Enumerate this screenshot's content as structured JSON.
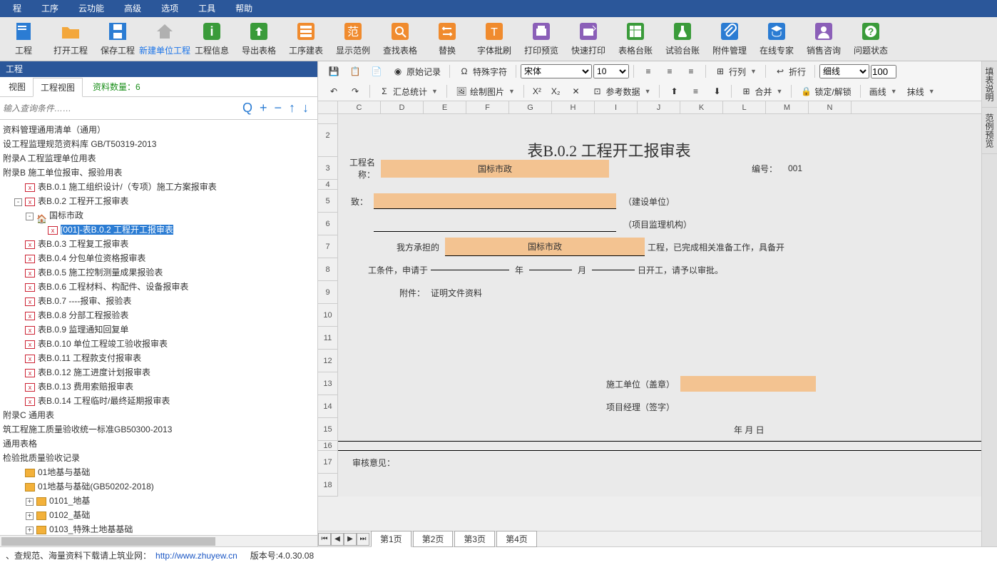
{
  "menu": [
    "程",
    "工序",
    "云功能",
    "高级",
    "选项",
    "工具",
    "帮助"
  ],
  "toolbar": [
    {
      "icon": "file-blue",
      "label": "工程"
    },
    {
      "icon": "folder-open",
      "label": "打开工程"
    },
    {
      "icon": "save",
      "label": "保存工程"
    },
    {
      "icon": "home-grey",
      "label": "新建单位工程",
      "accent": true
    },
    {
      "icon": "info",
      "label": "工程信息"
    },
    {
      "icon": "export",
      "label": "导出表格"
    },
    {
      "icon": "build",
      "label": "工序建表"
    },
    {
      "icon": "template",
      "label": "显示范例"
    },
    {
      "icon": "search",
      "label": "查找表格"
    },
    {
      "icon": "replace",
      "label": "替换"
    },
    {
      "icon": "font",
      "label": "字体批刷"
    },
    {
      "icon": "print",
      "label": "打印预览"
    },
    {
      "icon": "quick-print",
      "label": "快速打印"
    },
    {
      "icon": "ledger",
      "label": "表格台账"
    },
    {
      "icon": "test",
      "label": "试验台账"
    },
    {
      "icon": "attach",
      "label": "附件管理"
    },
    {
      "icon": "expert",
      "label": "在线专家"
    },
    {
      "icon": "sales",
      "label": "销售咨询"
    },
    {
      "icon": "status",
      "label": "问题状态"
    }
  ],
  "left": {
    "title": "工程",
    "tabs": [
      "视图",
      "工程视图"
    ],
    "info": "资料数量：6",
    "search_placeholder": "输入查询条件……",
    "tree": [
      {
        "lvl": 1,
        "t": "资料管理通用清单（通用）"
      },
      {
        "lvl": 1,
        "t": "设工程监理规范资料库  GB/T50319-2013"
      },
      {
        "lvl": 1,
        "t": "附录A 工程监理单位用表"
      },
      {
        "lvl": 1,
        "t": "附录B 施工单位报审、报验用表"
      },
      {
        "lvl": 2,
        "ico": "doc",
        "t": "表B.0.1 施工组织设计/（专项）施工方案报审表"
      },
      {
        "lvl": 2,
        "ico": "doc",
        "t": "表B.0.2 工程开工报审表",
        "exp": "-"
      },
      {
        "lvl": 3,
        "ico": "home",
        "t": "国标市政",
        "exp": "-"
      },
      {
        "lvl": 4,
        "ico": "doc",
        "t": "[001]-表B.0.2 工程开工报审表",
        "sel": true
      },
      {
        "lvl": 2,
        "ico": "doc",
        "t": "表B.0.3 工程复工报审表"
      },
      {
        "lvl": 2,
        "ico": "doc",
        "t": "表B.0.4 分包单位资格报审表"
      },
      {
        "lvl": 2,
        "ico": "doc",
        "t": "表B.0.5 施工控制测量成果报验表"
      },
      {
        "lvl": 2,
        "ico": "doc",
        "t": "表B.0.6 工程材料、构配件、设备报审表"
      },
      {
        "lvl": 2,
        "ico": "doc",
        "t": "表B.0.7 ----报审、报验表"
      },
      {
        "lvl": 2,
        "ico": "doc",
        "t": "表B.0.8 分部工程报验表"
      },
      {
        "lvl": 2,
        "ico": "doc",
        "t": "表B.0.9 监理通知回复单"
      },
      {
        "lvl": 2,
        "ico": "doc",
        "t": "表B.0.10 单位工程竣工验收报审表"
      },
      {
        "lvl": 2,
        "ico": "doc",
        "t": "表B.0.11 工程款支付报审表"
      },
      {
        "lvl": 2,
        "ico": "doc",
        "t": "表B.0.12 施工进度计划报审表"
      },
      {
        "lvl": 2,
        "ico": "doc",
        "t": "表B.0.13 费用索赔报审表"
      },
      {
        "lvl": 2,
        "ico": "doc",
        "t": "表B.0.14 工程临时/最终延期报审表"
      },
      {
        "lvl": 1,
        "t": "附录C 通用表"
      },
      {
        "lvl": 1,
        "t": "筑工程施工质量验收统一标准GB50300-2013"
      },
      {
        "lvl": 1,
        "t": "通用表格"
      },
      {
        "lvl": 1,
        "t": "检验批质量验收记录"
      },
      {
        "lvl": 2,
        "ico": "fld",
        "t": "01地基与基础"
      },
      {
        "lvl": 2,
        "ico": "fld",
        "t": "01地基与基础(GB50202-2018)"
      },
      {
        "lvl": 3,
        "ico": "fld",
        "exp": "+",
        "t": "0101_地基"
      },
      {
        "lvl": 3,
        "ico": "fld",
        "exp": "+",
        "t": "0102_基础"
      },
      {
        "lvl": 3,
        "ico": "fld",
        "exp": "+",
        "t": "0103_特殊土地基基础"
      }
    ]
  },
  "rtool": {
    "row1": [
      {
        "ico": "disk",
        "t": ""
      },
      {
        "ico": "copy",
        "t": ""
      },
      {
        "ico": "paste",
        "t": ""
      },
      {
        "ico": "orig",
        "t": "原始记录"
      },
      {
        "sep": true
      },
      {
        "ico": "omega",
        "t": "特殊字符"
      },
      {
        "sep": true
      },
      {
        "font_sel": "宋体"
      },
      {
        "size_sel": "10"
      },
      {
        "sep": true
      },
      {
        "ico": "al",
        "t": ""
      },
      {
        "ico": "ac",
        "t": ""
      },
      {
        "ico": "ar",
        "t": ""
      },
      {
        "sep": true
      },
      {
        "ico": "row",
        "t": "行列",
        "drop": true
      },
      {
        "sep": true
      },
      {
        "ico": "wrap",
        "t": "折行"
      },
      {
        "sep": true
      },
      {
        "sel": "细线"
      },
      {
        "num": "100"
      }
    ],
    "row2": [
      {
        "ico": "undo",
        "t": ""
      },
      {
        "ico": "redo",
        "t": ""
      },
      {
        "sep": true
      },
      {
        "ico": "sum",
        "t": "汇总统计",
        "drop": true
      },
      {
        "sep": true
      },
      {
        "ico": "img",
        "t": "绘制图片",
        "drop": true
      },
      {
        "sep": true
      },
      {
        "t": "X²"
      },
      {
        "t": "X₂"
      },
      {
        "ico": "del",
        "t": ""
      },
      {
        "ico": "ref",
        "t": "参考数据",
        "drop": true
      },
      {
        "sep": true
      },
      {
        "ico": "vt",
        "t": ""
      },
      {
        "ico": "vm",
        "t": ""
      },
      {
        "ico": "vb",
        "t": ""
      },
      {
        "sep": true
      },
      {
        "ico": "merge",
        "t": "合并",
        "drop": true
      },
      {
        "sep": true
      },
      {
        "ico": "lock",
        "t": "锁定/解锁"
      },
      {
        "sep": true
      },
      {
        "t": "画线",
        "drop": true
      },
      {
        "t": "抹线",
        "drop": true
      }
    ]
  },
  "sheet": {
    "cols": [
      "",
      "C",
      "D",
      "E",
      "F",
      "G",
      "H",
      "I",
      "J",
      "K",
      "L",
      "M",
      "N"
    ],
    "rows": [
      "",
      "2",
      "3",
      "4",
      "5",
      "6",
      "7",
      "8",
      "9",
      "10",
      "11",
      "12",
      "13",
      "14",
      "15",
      "16",
      "17",
      "18"
    ],
    "title": "表B.0.2 工程开工报审表",
    "proj_label": "工程名称：",
    "proj_name": "国标市政",
    "num_label": "编号：",
    "num": "001",
    "to": "致：",
    "unit1": "（建设单位）",
    "unit2": "（项目监理机构）",
    "we": "我方承担的",
    "proj2": "国标市政",
    "tail": "工程，已完成相关准备工作，具备开",
    "cond": "工条件，申请于",
    "y": "年",
    "m": "月",
    "d": "日开工，请予以审批。",
    "att": "附件：",
    "att_v": "证明文件资料",
    "cu": "施工单位（盖章）",
    "pm": "项目经理（签字）",
    "ymd": "年   月   日",
    "rev": "审核意见：",
    "tabs": [
      "第1页",
      "第2页",
      "第3页",
      "第4页"
    ]
  },
  "vtabs": [
    "填表说明",
    "范例预览"
  ],
  "status": {
    "pre": "、查规范、海量资料下载请上筑业网：",
    "url": "http://www.zhuyew.cn",
    "ver": "版本号:4.0.30.08"
  }
}
